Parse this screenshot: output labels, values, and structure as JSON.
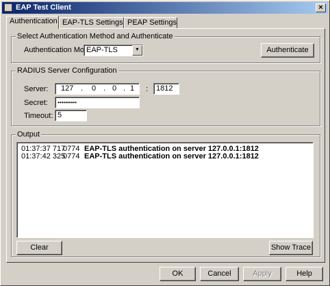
{
  "window": {
    "title": "EAP Test Client",
    "close_glyph": "×"
  },
  "tabs": [
    {
      "label": "Authentication"
    },
    {
      "label": "EAP-TLS Settings"
    },
    {
      "label": "PEAP Settings"
    }
  ],
  "auth": {
    "group_title": "Select Authentication Method and Authenticate",
    "mode_label": "Authentication Mode:",
    "mode_value": "EAP-TLS",
    "authenticate_button": "Authenticate"
  },
  "radius": {
    "group_title": "RADIUS Server Configuration",
    "server_label": "Server:",
    "ip": [
      "127",
      "0",
      "0",
      "1"
    ],
    "port_separator": ":",
    "port": "1812",
    "secret_label": "Secret:",
    "secret_value": "••••••••••",
    "timeout_label": "Timeout:",
    "timeout_value": "5"
  },
  "output": {
    "group_title": "Output",
    "entries": [
      {
        "time": "01:37:37 717",
        "code": "0774",
        "message": "EAP-TLS authentication on server 127.0.0.1:1812"
      },
      {
        "time": "01:37:42 325",
        "code": "0774",
        "message": "EAP-TLS authentication on server 127.0.0.1:1812"
      }
    ],
    "clear_button": "Clear",
    "show_trace_button": "Show Trace"
  },
  "dialog_buttons": {
    "ok": "OK",
    "cancel": "Cancel",
    "apply": "Apply",
    "help": "Help"
  }
}
